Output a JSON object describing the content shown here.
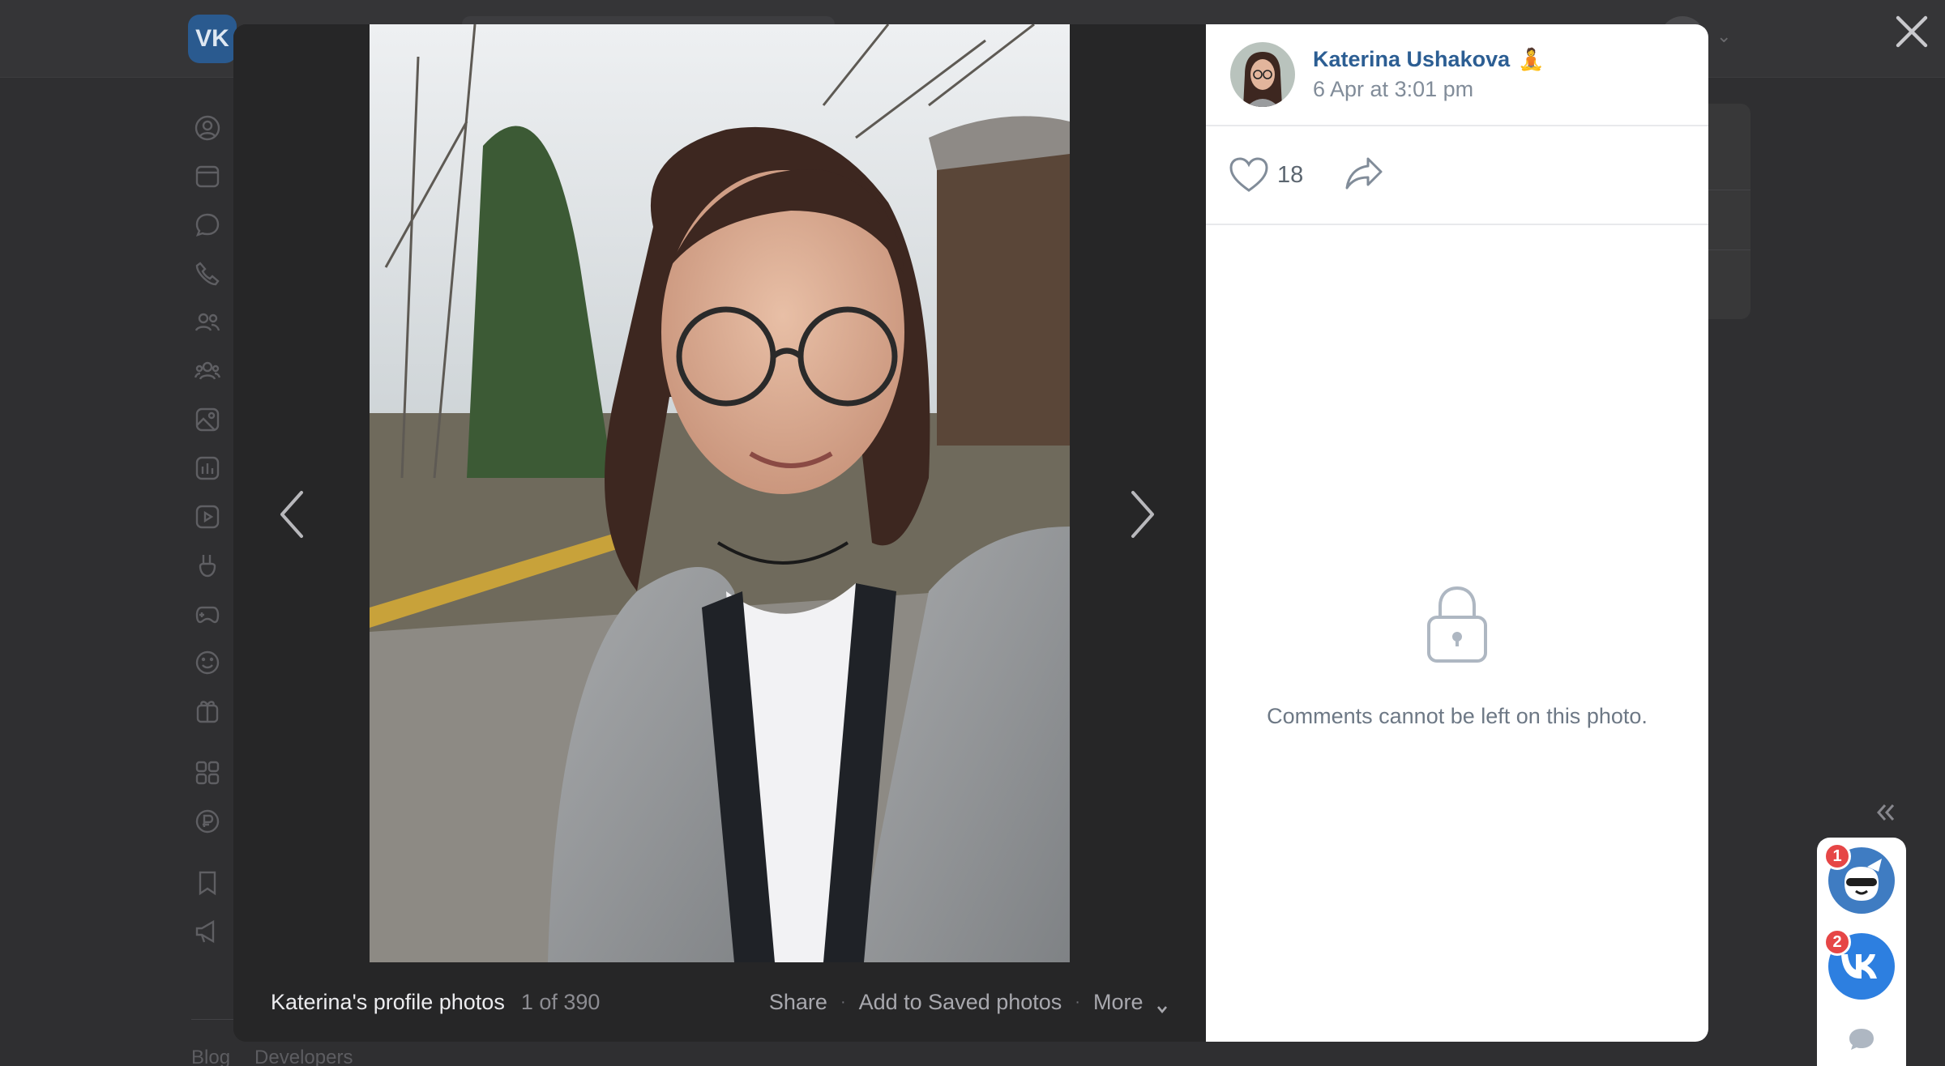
{
  "background": {
    "logo_text": "VK",
    "footer_links": [
      "Blog",
      "Developers"
    ]
  },
  "viewer": {
    "album_name": "Katerina's profile photos",
    "counter": "1 of 390",
    "actions": {
      "share": "Share",
      "save": "Add to Saved photos",
      "more": "More"
    }
  },
  "post": {
    "author_name": "Katerina Ushakova",
    "author_emoji": "🧘",
    "date": "6 Apr at 3:01 pm",
    "likes": "18",
    "comments_locked_text": "Comments cannot be left on this photo."
  },
  "chat_widget": {
    "badges": [
      "1",
      "2"
    ]
  },
  "colors": {
    "accent": "#2c5e93",
    "muted": "#818c99",
    "badge": "#e64646",
    "overlay": "#262627"
  }
}
